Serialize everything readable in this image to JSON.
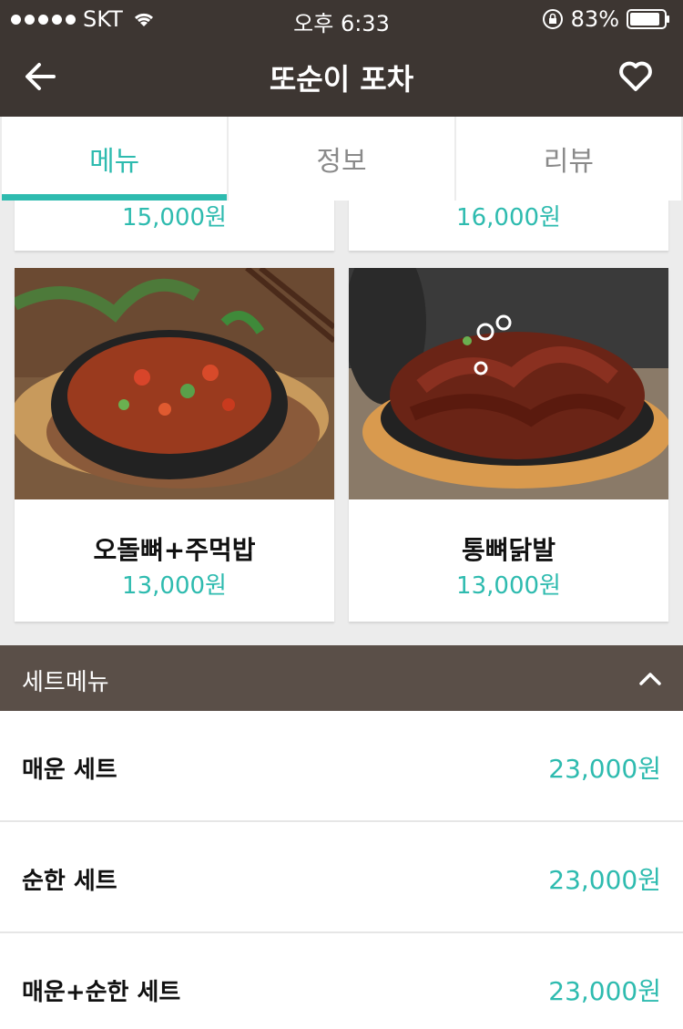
{
  "status_bar": {
    "carrier": "SKT",
    "time": "오후 6:33",
    "battery": "83%"
  },
  "header": {
    "title": "또순이 포차",
    "back_icon": "arrow-left-icon",
    "favorite_icon": "heart-outline-icon"
  },
  "tabs": [
    {
      "label": "메뉴",
      "active": true
    },
    {
      "label": "정보",
      "active": false
    },
    {
      "label": "리뷰",
      "active": false
    }
  ],
  "menu_items": [
    {
      "name": "",
      "price": "15,000원"
    },
    {
      "name": "",
      "price": "16,000원"
    },
    {
      "name": "오돌뼈+주먹밥",
      "price": "13,000원"
    },
    {
      "name": "통뼈닭발",
      "price": "13,000원"
    }
  ],
  "set_menu": {
    "title": "세트메뉴",
    "collapse_icon": "chevron-up-icon",
    "items": [
      {
        "name": "매운 세트",
        "price": "23,000원"
      },
      {
        "name": "순한 세트",
        "price": "23,000원"
      },
      {
        "name": "매운+순한 세트",
        "price": "23,000원"
      }
    ]
  },
  "colors": {
    "accent": "#2ebbaf",
    "header_bg": "#3d3632",
    "section_bg": "#5a4f48"
  }
}
